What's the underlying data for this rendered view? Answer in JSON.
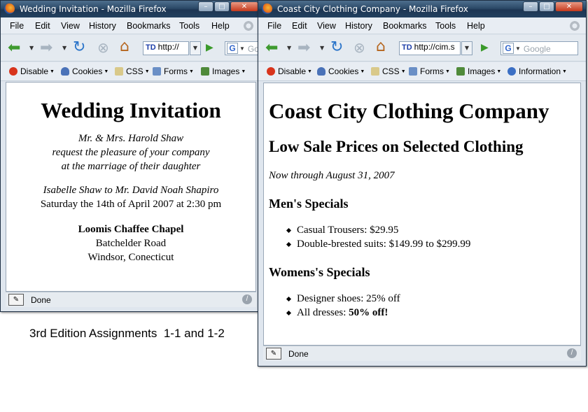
{
  "caption": "3rd Edition Assignments  1-1 and 1-2",
  "menu": [
    "File",
    "Edit",
    "View",
    "History",
    "Bookmarks",
    "Tools",
    "Help"
  ],
  "devbar": {
    "disable": "Disable",
    "cookies": "Cookies",
    "css": "CSS",
    "forms": "Forms",
    "images": "Images",
    "information": "Information"
  },
  "status": "Done",
  "win1": {
    "title": "Wedding Invitation - Mozilla Firefox",
    "url": "http://",
    "page": {
      "heading": "Wedding Invitation",
      "invite_lines": [
        "Mr. & Mrs. Harold Shaw",
        "request the pleasure of your company",
        "at the marriage of their daughter"
      ],
      "couple": "Isabelle Shaw to Mr. David Noah Shapiro",
      "date": "Saturday the 14th of April 2007 at 2:30 pm",
      "place": "Loomis Chaffee Chapel",
      "street": "Batchelder Road",
      "city": "Windsor, Conecticut"
    }
  },
  "win2": {
    "title": "Coast City Clothing Company - Mozilla Firefox",
    "url": "http://cim.s",
    "search_placeholder": "Google",
    "page": {
      "heading": "Coast City Clothing Company",
      "subheading": "Low Sale Prices on Selected Clothing",
      "sale_dates": "Now through August 31, 2007",
      "mens_heading": "Men's Specials",
      "mens_items": [
        "Casual Trousers: $29.95",
        "Double-brested suits: $149.99 to $299.99"
      ],
      "womens_heading": "Womens's Specials",
      "womens_item1_text": "Designer shoes: 25% off",
      "womens_item2_text": "All dresses: ",
      "womens_item2_bold": "50% off!"
    }
  },
  "colors": {
    "titlebar": "#2c4a68",
    "chrome": "#e4eaf0",
    "go_green": "#3a9a2a"
  }
}
